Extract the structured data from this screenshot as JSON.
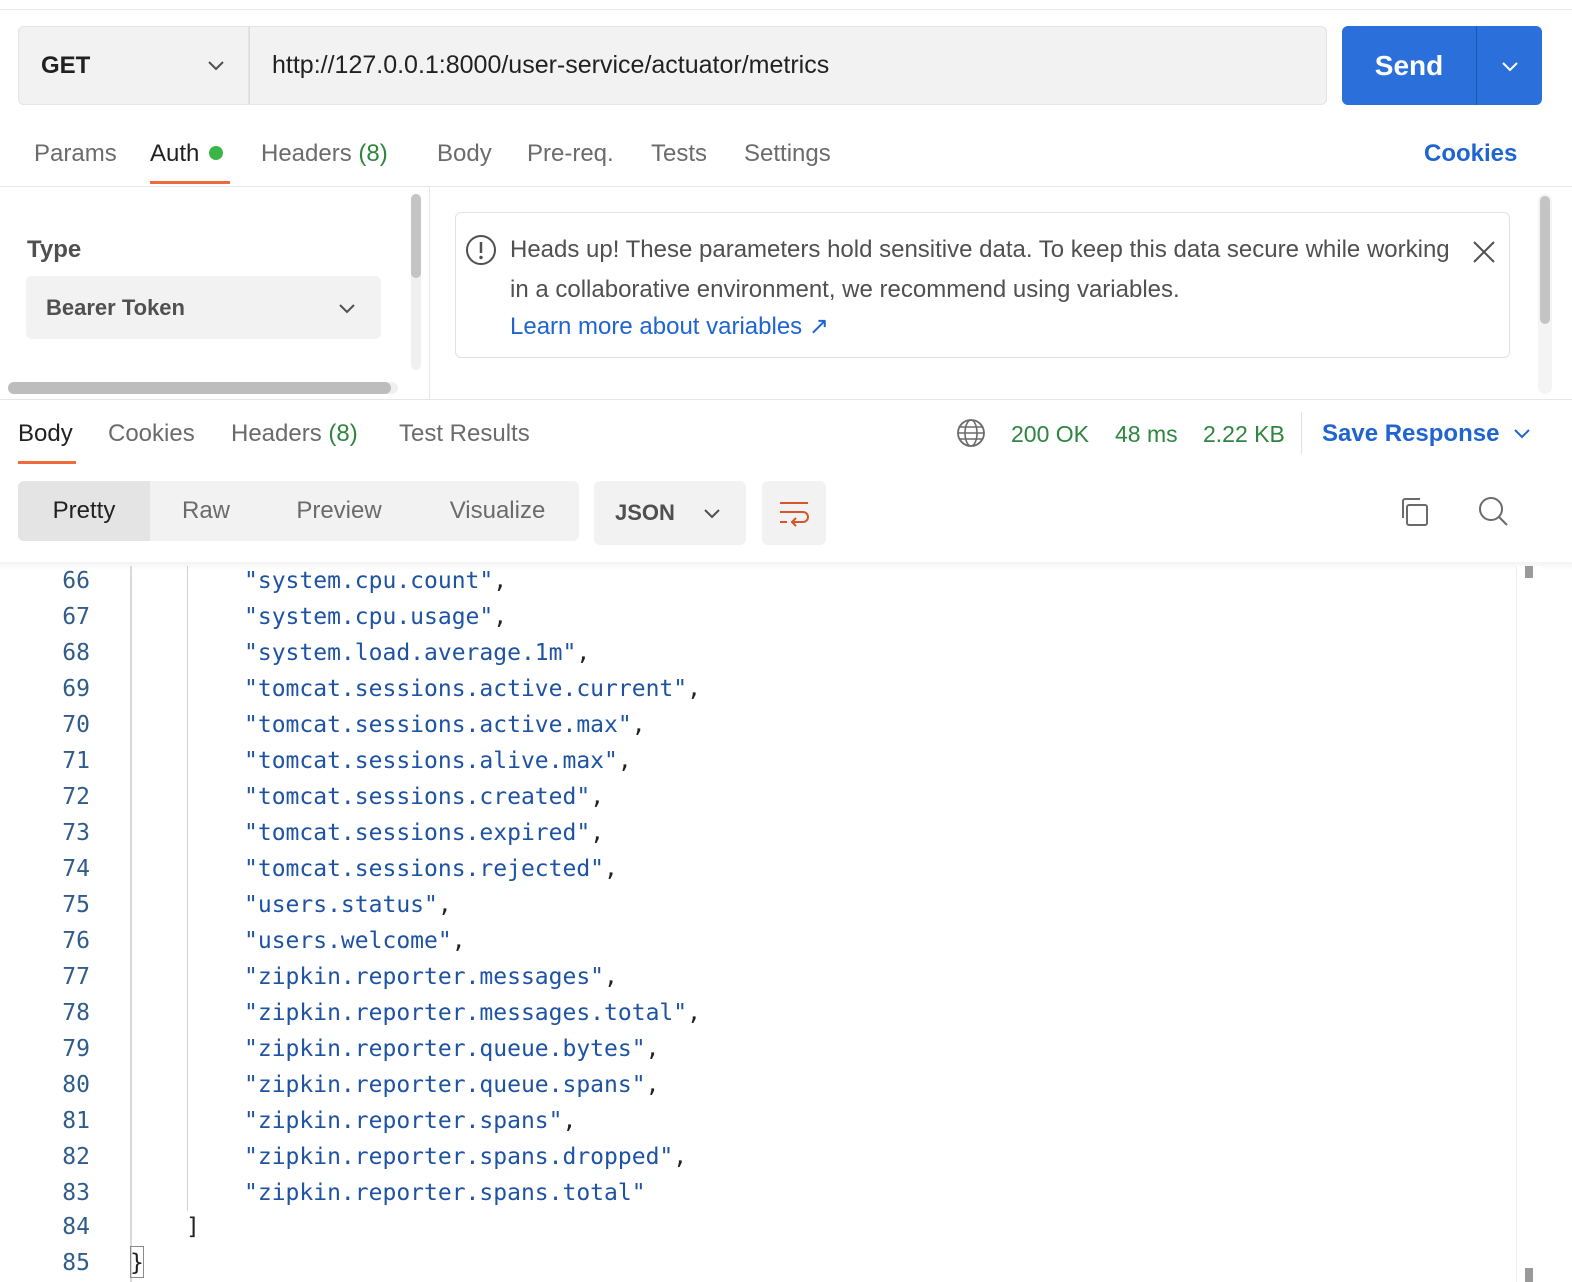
{
  "request": {
    "method": "GET",
    "url": "http://127.0.0.1:8000/user-service/actuator/metrics",
    "send_label": "Send"
  },
  "request_tabs": {
    "params": "Params",
    "auth": "Auth",
    "headers": "Headers",
    "headers_count": "(8)",
    "body": "Body",
    "prereq": "Pre-req.",
    "tests": "Tests",
    "settings": "Settings",
    "cookies": "Cookies"
  },
  "auth": {
    "type_label": "Type",
    "type_value": "Bearer Token",
    "alert_text": "Heads up! These parameters hold sensitive data. To keep this data secure while working in a collaborative environment, we recommend using variables.",
    "alert_link": "Learn more about variables ↗"
  },
  "response_tabs": {
    "body": "Body",
    "cookies": "Cookies",
    "headers": "Headers",
    "headers_count": "(8)",
    "test_results": "Test Results"
  },
  "response_status": {
    "status": "200 OK",
    "time": "48 ms",
    "size": "2.22 KB",
    "save_response": "Save Response"
  },
  "view": {
    "pretty": "Pretty",
    "raw": "Raw",
    "preview": "Preview",
    "visualize": "Visualize",
    "format": "JSON"
  },
  "code": {
    "lines": [
      {
        "num": "66",
        "text": "\"system.cpu.count\"",
        "punc": ","
      },
      {
        "num": "67",
        "text": "\"system.cpu.usage\"",
        "punc": ","
      },
      {
        "num": "68",
        "text": "\"system.load.average.1m\"",
        "punc": ","
      },
      {
        "num": "69",
        "text": "\"tomcat.sessions.active.current\"",
        "punc": ","
      },
      {
        "num": "70",
        "text": "\"tomcat.sessions.active.max\"",
        "punc": ","
      },
      {
        "num": "71",
        "text": "\"tomcat.sessions.alive.max\"",
        "punc": ","
      },
      {
        "num": "72",
        "text": "\"tomcat.sessions.created\"",
        "punc": ","
      },
      {
        "num": "73",
        "text": "\"tomcat.sessions.expired\"",
        "punc": ","
      },
      {
        "num": "74",
        "text": "\"tomcat.sessions.rejected\"",
        "punc": ","
      },
      {
        "num": "75",
        "text": "\"users.status\"",
        "punc": ","
      },
      {
        "num": "76",
        "text": "\"users.welcome\"",
        "punc": ","
      },
      {
        "num": "77",
        "text": "\"zipkin.reporter.messages\"",
        "punc": ","
      },
      {
        "num": "78",
        "text": "\"zipkin.reporter.messages.total\"",
        "punc": ","
      },
      {
        "num": "79",
        "text": "\"zipkin.reporter.queue.bytes\"",
        "punc": ","
      },
      {
        "num": "80",
        "text": "\"zipkin.reporter.queue.spans\"",
        "punc": ","
      },
      {
        "num": "81",
        "text": "\"zipkin.reporter.spans\"",
        "punc": ","
      },
      {
        "num": "82",
        "text": "\"zipkin.reporter.spans.dropped\"",
        "punc": ","
      },
      {
        "num": "83",
        "text": "\"zipkin.reporter.spans.total\"",
        "punc": ""
      }
    ],
    "line_84": "84",
    "line_84_text": "]",
    "line_85": "85",
    "line_85_text": "}"
  }
}
